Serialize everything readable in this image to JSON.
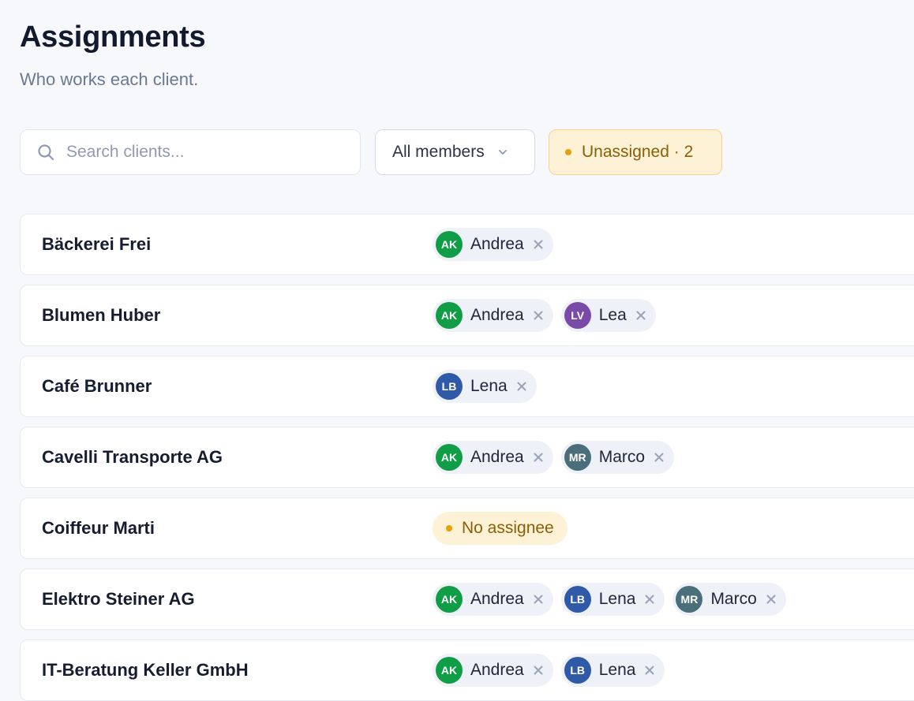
{
  "header": {
    "title": "Assignments",
    "subtitle": "Who works each client."
  },
  "toolbar": {
    "search_placeholder": "Search clients...",
    "member_filter": "All members",
    "unassigned_filter": "Unassigned · 2"
  },
  "colors": {
    "andrea": "#0f9d46",
    "lea": "#7a4aa8",
    "lena": "#2f5aa8",
    "marco": "#4a6e7c",
    "warning": "#e5a00d"
  },
  "clients": [
    {
      "name": "Bäckerei Frei",
      "assignees": [
        {
          "initials": "AK",
          "name": "Andrea",
          "color": "#0f9d46"
        }
      ]
    },
    {
      "name": "Blumen Huber",
      "assignees": [
        {
          "initials": "AK",
          "name": "Andrea",
          "color": "#0f9d46"
        },
        {
          "initials": "LV",
          "name": "Lea",
          "color": "#7a4aa8"
        }
      ]
    },
    {
      "name": "Café Brunner",
      "assignees": [
        {
          "initials": "LB",
          "name": "Lena",
          "color": "#2f5aa8"
        }
      ]
    },
    {
      "name": "Cavelli Transporte AG",
      "assignees": [
        {
          "initials": "AK",
          "name": "Andrea",
          "color": "#0f9d46"
        },
        {
          "initials": "MR",
          "name": "Marco",
          "color": "#4a6e7c"
        }
      ]
    },
    {
      "name": "Coiffeur Marti",
      "assignees": [],
      "empty_label": "No assignee"
    },
    {
      "name": "Elektro Steiner AG",
      "assignees": [
        {
          "initials": "AK",
          "name": "Andrea",
          "color": "#0f9d46"
        },
        {
          "initials": "LB",
          "name": "Lena",
          "color": "#2f5aa8"
        },
        {
          "initials": "MR",
          "name": "Marco",
          "color": "#4a6e7c"
        }
      ]
    },
    {
      "name": "IT-Beratung Keller GmbH",
      "assignees": [
        {
          "initials": "AK",
          "name": "Andrea",
          "color": "#0f9d46"
        },
        {
          "initials": "LB",
          "name": "Lena",
          "color": "#2f5aa8"
        }
      ]
    }
  ]
}
